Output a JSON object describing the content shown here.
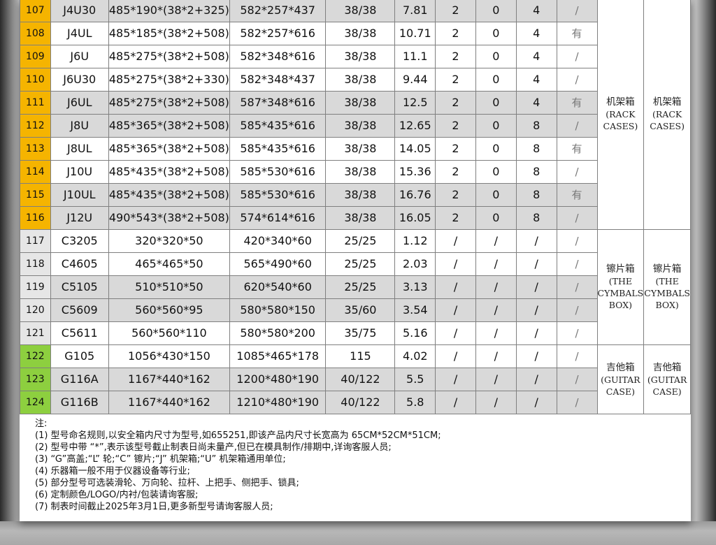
{
  "rows": [
    {
      "no": "107",
      "model": "J4U30",
      "inner": "485*190*(38*2+325)",
      "outer": "582*257*437",
      "thick": "38/38",
      "weight": "7.81",
      "c1": "2",
      "c2": "0",
      "c3": "4",
      "c4": "/",
      "band": "o",
      "gray": true
    },
    {
      "no": "108",
      "model": "J4UL",
      "inner": "485*185*(38*2+508)",
      "outer": "582*257*616",
      "thick": "38/38",
      "weight": "10.71",
      "c1": "2",
      "c2": "0",
      "c3": "4",
      "c4": "有",
      "band": "o",
      "gray": false
    },
    {
      "no": "109",
      "model": "J6U",
      "inner": "485*275*(38*2+508)",
      "outer": "582*348*616",
      "thick": "38/38",
      "weight": "11.1",
      "c1": "2",
      "c2": "0",
      "c3": "4",
      "c4": "/",
      "band": "o",
      "gray": false
    },
    {
      "no": "110",
      "model": "J6U30",
      "inner": "485*275*(38*2+330)",
      "outer": "582*348*437",
      "thick": "38/38",
      "weight": "9.44",
      "c1": "2",
      "c2": "0",
      "c3": "4",
      "c4": "/",
      "band": "o",
      "gray": false
    },
    {
      "no": "111",
      "model": "J6UL",
      "inner": "485*275*(38*2+508)",
      "outer": "587*348*616",
      "thick": "38/38",
      "weight": "12.5",
      "c1": "2",
      "c2": "0",
      "c3": "4",
      "c4": "有",
      "band": "o",
      "gray": true
    },
    {
      "no": "112",
      "model": "J8U",
      "inner": "485*365*(38*2+508)",
      "outer": "585*435*616",
      "thick": "38/38",
      "weight": "12.65",
      "c1": "2",
      "c2": "0",
      "c3": "8",
      "c4": "/",
      "band": "o",
      "gray": true
    },
    {
      "no": "113",
      "model": "J8UL",
      "inner": "485*365*(38*2+508)",
      "outer": "585*435*616",
      "thick": "38/38",
      "weight": "14.05",
      "c1": "2",
      "c2": "0",
      "c3": "8",
      "c4": "有",
      "band": "o",
      "gray": false
    },
    {
      "no": "114",
      "model": "J10U",
      "inner": "485*435*(38*2+508)",
      "outer": "585*530*616",
      "thick": "38/38",
      "weight": "15.36",
      "c1": "2",
      "c2": "0",
      "c3": "8",
      "c4": "/",
      "band": "o",
      "gray": false
    },
    {
      "no": "115",
      "model": "J10UL",
      "inner": "485*435*(38*2+508)",
      "outer": "585*530*616",
      "thick": "38/38",
      "weight": "16.76",
      "c1": "2",
      "c2": "0",
      "c3": "8",
      "c4": "有",
      "band": "o",
      "gray": true
    },
    {
      "no": "116",
      "model": "J12U",
      "inner": "490*543*(38*2+508)",
      "outer": "574*614*616",
      "thick": "38/38",
      "weight": "16.05",
      "c1": "2",
      "c2": "0",
      "c3": "8",
      "c4": "/",
      "band": "o",
      "gray": true
    },
    {
      "no": "117",
      "model": "C3205",
      "inner": "320*320*50",
      "outer": "420*340*60",
      "thick": "25/25",
      "weight": "1.12",
      "c1": "/",
      "c2": "/",
      "c3": "/",
      "c4": "/",
      "band": "p",
      "gray": false
    },
    {
      "no": "118",
      "model": "C4605",
      "inner": "465*465*50",
      "outer": "565*490*60",
      "thick": "25/25",
      "weight": "2.03",
      "c1": "/",
      "c2": "/",
      "c3": "/",
      "c4": "/",
      "band": "p",
      "gray": false
    },
    {
      "no": "119",
      "model": "C5105",
      "inner": "510*510*50",
      "outer": "620*540*60",
      "thick": "25/25",
      "weight": "3.13",
      "c1": "/",
      "c2": "/",
      "c3": "/",
      "c4": "/",
      "band": "p",
      "gray": true
    },
    {
      "no": "120",
      "model": "C5609",
      "inner": "560*560*95",
      "outer": "580*580*150",
      "thick": "35/60",
      "weight": "3.54",
      "c1": "/",
      "c2": "/",
      "c3": "/",
      "c4": "/",
      "band": "p",
      "gray": true
    },
    {
      "no": "121",
      "model": "C5611",
      "inner": "560*560*110",
      "outer": "580*580*200",
      "thick": "35/75",
      "weight": "5.16",
      "c1": "/",
      "c2": "/",
      "c3": "/",
      "c4": "/",
      "band": "p",
      "gray": false
    },
    {
      "no": "122",
      "model": "G105",
      "inner": "1056*430*150",
      "outer": "1085*465*178",
      "thick": "115",
      "weight": "4.02",
      "c1": "/",
      "c2": "/",
      "c3": "/",
      "c4": "/",
      "band": "g",
      "gray": false
    },
    {
      "no": "123",
      "model": "G116A",
      "inner": "1167*440*162",
      "outer": "1200*480*190",
      "thick": "40/122",
      "weight": "5.5",
      "c1": "/",
      "c2": "/",
      "c3": "/",
      "c4": "/",
      "band": "g",
      "gray": true
    },
    {
      "no": "124",
      "model": "G116B",
      "inner": "1167*440*162",
      "outer": "1210*480*190",
      "thick": "40/122",
      "weight": "5.8",
      "c1": "/",
      "c2": "/",
      "c3": "/",
      "c4": "/",
      "band": "g",
      "gray": true
    }
  ],
  "categories": [
    {
      "start": 0,
      "span": 10,
      "cn": "机架箱",
      "en1": "(RACK",
      "en2": "CASES)"
    },
    {
      "start": 10,
      "span": 5,
      "cn": "镲片箱",
      "en1": "(THE",
      "en2": "CYMBALS",
      "en3": "BOX)"
    },
    {
      "start": 15,
      "span": 3,
      "cn": "吉他箱",
      "en1": "(GUITAR",
      "en2": "CASE)"
    }
  ],
  "notes": {
    "title": "注:",
    "lines": [
      "(1) 型号命名规则,以安全箱内尺寸为型号,如655251,即该产品内尺寸长宽高为  65CM*52CM*51CM;",
      "(2) 型号中带 “*”,表示该型号截止制表日尚未量产,但已在模具制作/排期中,详询客服人员;",
      "(3) “G”高盖;“L” 轮;“C” 镲片;“J” 机架箱;“U” 机架箱通用单位;",
      "(4) 乐器箱一般不用于仪器设备等行业;",
      "(5) 部分型号可选装滑轮、万向轮、拉杆、上把手、侧把手、锁具;",
      "(6) 定制颜色/LOGO/内衬/包装请询客服;",
      "(7) 制表时间截止2025年3月1日,更多新型号请询客服人员;"
    ]
  }
}
